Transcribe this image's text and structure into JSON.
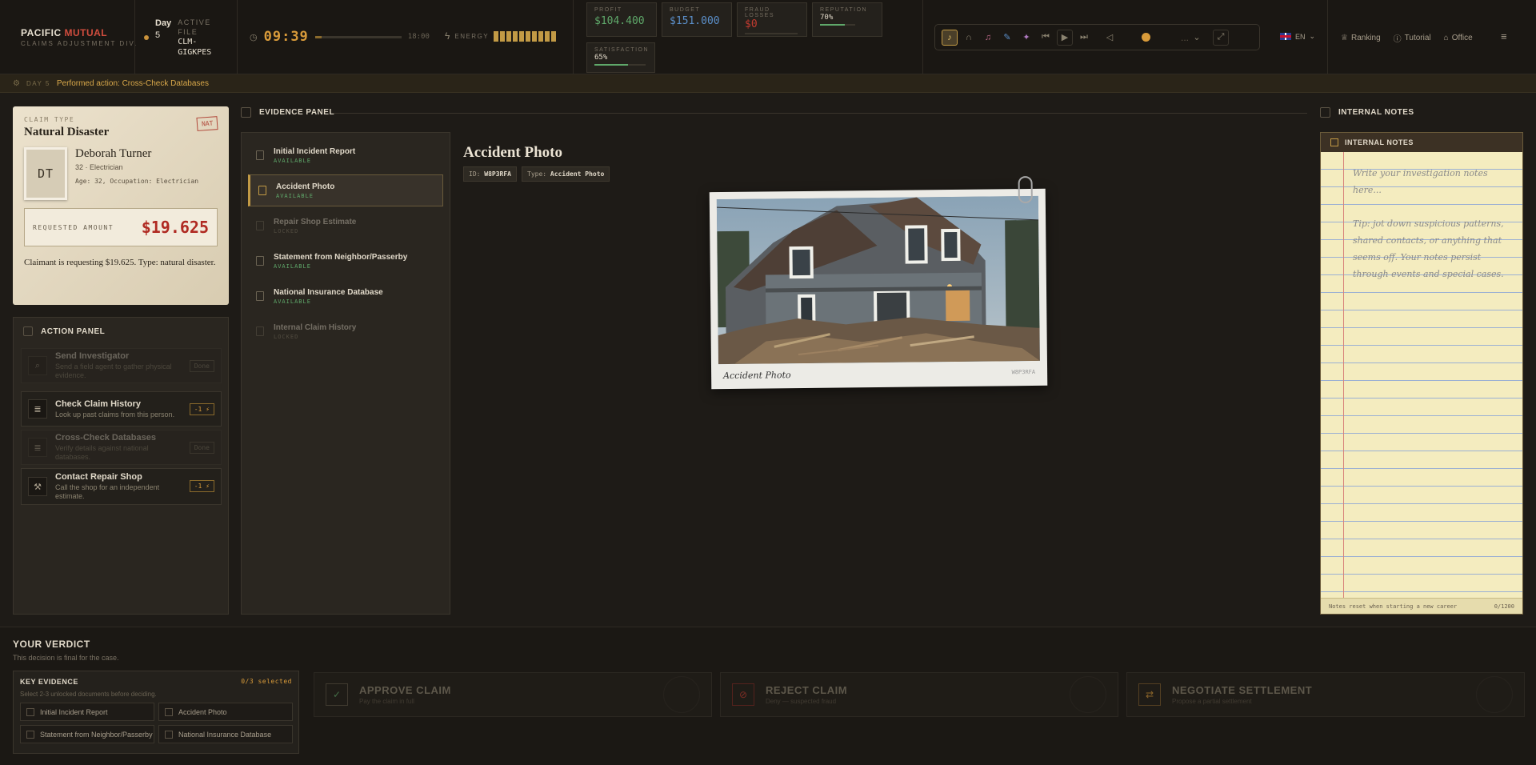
{
  "brand": {
    "name_part1": "PACIFIC ",
    "name_part2": "MUTUAL",
    "division": "CLAIMS ADJUSTMENT DIV."
  },
  "day": {
    "label": "Day",
    "number": "5",
    "active_file_label": "ACTIVE FILE",
    "file_id": "CLM-GIGKPES"
  },
  "clock": {
    "time": "09:39",
    "end_time": "18:00",
    "progress": 0.08
  },
  "energy": {
    "label": "ENERGY",
    "segments": 10,
    "filled": 10
  },
  "stats": {
    "profit": {
      "label": "PROFIT",
      "value": "$104.400",
      "color": "#5fa86a"
    },
    "budget": {
      "label": "BUDGET",
      "value": "$151.000",
      "color": "#5b8fc9"
    },
    "fraud_losses": {
      "label": "FRAUD LOSSES",
      "value": "$0",
      "color": "#c23b30"
    },
    "reputation": {
      "label": "REPUTATION",
      "value": "70%",
      "level": 0.7
    },
    "satisfaction": {
      "label": "SATISFACTION",
      "value": "65%",
      "level": 0.65
    }
  },
  "media": {
    "volume_text": "..."
  },
  "lang": {
    "code": "EN"
  },
  "nav": {
    "ranking": "Ranking",
    "tutorial": "Tutorial",
    "office": "Office"
  },
  "strip": {
    "day": "DAY 5",
    "message": "Performed action: Cross-Check Databases"
  },
  "claim": {
    "type_label": "CLAIM TYPE",
    "type": "Natural Disaster",
    "stamp": "NAT",
    "initials": "DT",
    "name": "Deborah Turner",
    "sub": "32 · Electrician",
    "meta": "Age: 32, Occupation: Electrician",
    "amount_label": "REQUESTED AMOUNT",
    "amount": "$19.625",
    "description": "Claimant is requesting $19.625. Type: natural disaster."
  },
  "action_panel": {
    "title": "ACTION PANEL",
    "actions": [
      {
        "title": "Send Investigator",
        "desc": "Send a field agent to gather physical evidence.",
        "badge": "Done",
        "done": true
      },
      {
        "title": "Check Claim History",
        "desc": "Look up past claims from this person.",
        "badge": "-1 ⚡",
        "done": false
      },
      {
        "title": "Cross-Check Databases",
        "desc": "Verify details against national databases.",
        "badge": "Done",
        "done": true
      },
      {
        "title": "Contact Repair Shop",
        "desc": "Call the shop for an independent estimate.",
        "badge": "-1 ⚡",
        "done": false
      }
    ]
  },
  "evidence": {
    "title": "EVIDENCE PANEL",
    "items": [
      {
        "title": "Initial Incident Report",
        "status": "AVAILABLE"
      },
      {
        "title": "Accident Photo",
        "status": "AVAILABLE"
      },
      {
        "title": "Repair Shop Estimate",
        "status": "LOCKED"
      },
      {
        "title": "Statement from Neighbor/Passerby",
        "status": "AVAILABLE"
      },
      {
        "title": "National Insurance Database",
        "status": "AVAILABLE"
      },
      {
        "title": "Internal Claim History",
        "status": "LOCKED"
      }
    ],
    "doc": {
      "title": "Accident Photo",
      "id_label": "ID:",
      "id": "W8P3RFA",
      "type_label": "Type:",
      "type": "Accident Photo",
      "caption": "Accident Photo",
      "photo_id": "W8P3RFA"
    }
  },
  "notes": {
    "title": "INTERNAL NOTES",
    "placeholder": "Write your investigation notes here...",
    "tip": "Tip: jot down suspicious patterns, shared contacts, or anything that seems off. Your notes persist through events and special cases.",
    "footer": "Notes reset when starting a new career",
    "count": "0/1200"
  },
  "verdict": {
    "title": "YOUR VERDICT",
    "subtitle": "This decision is final for the case.",
    "key_evidence": {
      "title": "KEY EVIDENCE",
      "count": "0/3 selected",
      "hint": "Select 2-3 unlocked documents before deciding.",
      "items": [
        "Initial Incident Report",
        "Accident Photo",
        "Statement from Neighbor/Passerby",
        "National Insurance Database"
      ]
    },
    "approve": {
      "title": "APPROVE CLAIM",
      "sub": "Pay the claim in full"
    },
    "reject": {
      "title": "REJECT CLAIM",
      "sub": "Deny — suspected fraud"
    },
    "negotiate": {
      "title": "NEGOTIATE SETTLEMENT",
      "sub": "Propose a partial settlement"
    }
  }
}
